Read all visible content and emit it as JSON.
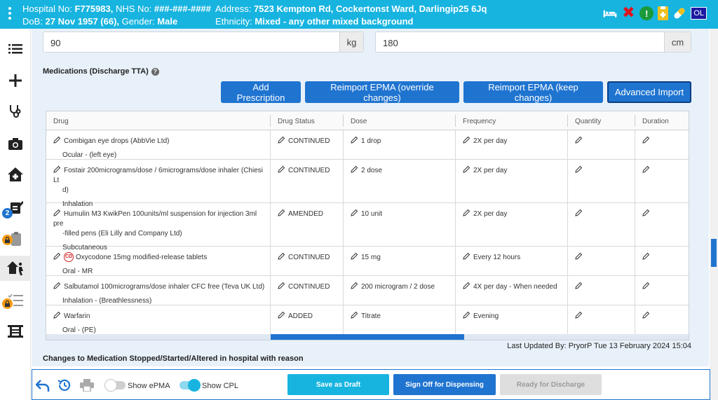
{
  "header": {
    "hospital_no_label": "Hospital No:",
    "hospital_no": "F775983,",
    "nhs_no_label": "NHS No:",
    "nhs_no": "###-###-####",
    "dob_label": "DoB:",
    "dob": "27 Nov 1957 (66),",
    "gender_label": "Gender:",
    "gender": "Male",
    "address_label": "Address:",
    "address": "7523 Kempton Rd, Cockertonst Ward, Darlingip25 6Jq",
    "ethnicity_label": "Ethnicity:",
    "ethnicity": "Mixed - any other mixed background",
    "icons": [
      "bed-icon",
      "x-icon",
      "alert-icon",
      "clipboard-icon",
      "pill-icon"
    ],
    "user_initials": "OL"
  },
  "measurements": [
    {
      "value": "90",
      "unit": "kg"
    },
    {
      "value": "180",
      "unit": "cm"
    }
  ],
  "section_title": "Medications (Discharge TTA)",
  "buttons": {
    "add": "Add Prescription",
    "reimport_override": "Reimport EPMA (override changes)",
    "reimport_keep": "Reimport EPMA (keep changes)",
    "advanced_import": "Advanced Import"
  },
  "table": {
    "columns": [
      "Drug",
      "Drug Status",
      "Dose",
      "Frequency",
      "Quantity",
      "Duration"
    ],
    "rows": [
      {
        "drug1": "Combigan eye drops (AbbVie Ltd)",
        "drug2": "",
        "route": "Ocular - (left eye)",
        "status": "CONTINUED",
        "dose": "1 drop",
        "frequency": "2X per day"
      },
      {
        "drug1": "Fostair 200micrograms/dose / 6micrograms/dose inhaler (Chiesi Lt",
        "drug2": "d)",
        "route": "Inhalation",
        "status": "CONTINUED",
        "dose": "2 dose",
        "frequency": "2X per day"
      },
      {
        "drug1": "Humulin M3 KwikPen 100units/ml suspension for injection 3ml pre",
        "drug2": "-filled pens (Eli Lilly and Company Ltd)",
        "route": "Subcutaneous",
        "status": "AMENDED",
        "dose": "10 unit",
        "frequency": "2X per day"
      },
      {
        "cd": "CD",
        "drug1": "Oxycodone 15mg modified-release tablets",
        "drug2": "",
        "route": "Oral - MR",
        "status": "CONTINUED",
        "dose": "15 mg",
        "frequency": "Every 12 hours"
      },
      {
        "drug1": "Salbutamol 100micrograms/dose inhaler CFC free (Teva UK Ltd)",
        "drug2": "",
        "route": "Inhalation - (Breathlessness)",
        "status": "CONTINUED",
        "dose": "200 microgram / 2 dose",
        "frequency": "4X per day - When needed"
      },
      {
        "drug1": "Warfarin",
        "drug2": "",
        "route": "Oral - (PE)",
        "status": "ADDED",
        "dose": "Titrate",
        "frequency": "Evening"
      }
    ]
  },
  "last_updated": "Last Updated By: PryorP Tue 13 February 2024 15:04",
  "changes_title": "Changes to Medication Stopped/Started/Altered in hospital with reason",
  "sidebar": {
    "items": [
      {
        "icon": "list-icon"
      },
      {
        "icon": "plus-icon"
      },
      {
        "icon": "stethoscope-icon"
      },
      {
        "icon": "camera-icon"
      },
      {
        "icon": "home-plus-icon"
      },
      {
        "icon": "prescription-edit-icon",
        "badge": "2"
      },
      {
        "icon": "clipboard-locked-icon",
        "badge": "lock"
      },
      {
        "icon": "discharge-icon"
      },
      {
        "icon": "checklist-locked-icon",
        "badge": "lock"
      },
      {
        "icon": "ward-icon"
      }
    ]
  },
  "footer": {
    "show_epma": "Show ePMA",
    "show_cpl": "Show CPL",
    "save_draft": "Save as Draft",
    "sign_off": "Sign Off for Dispensing",
    "ready_discharge": "Ready for Discharge"
  }
}
